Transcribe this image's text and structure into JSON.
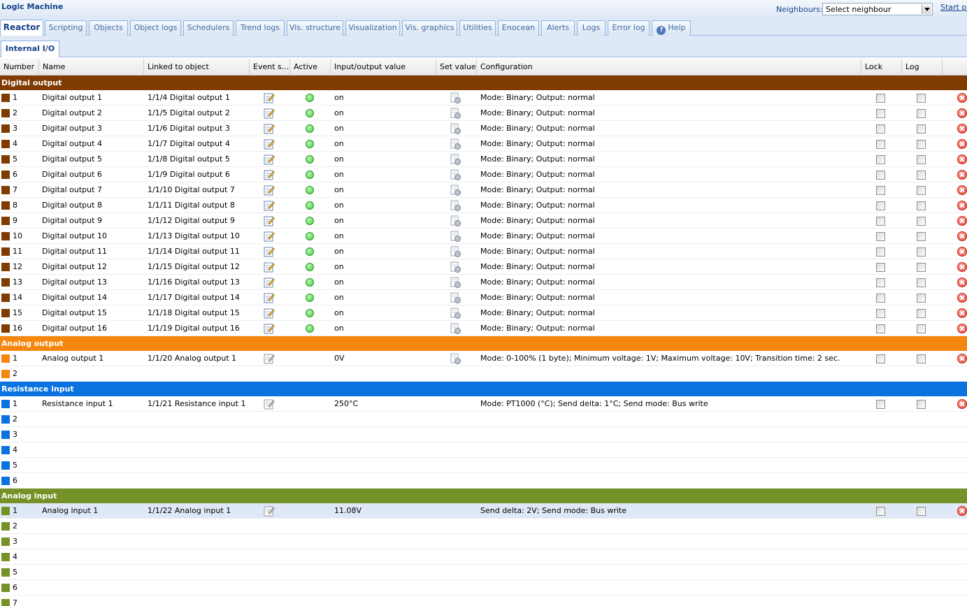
{
  "app": {
    "title": "Logic Machine",
    "neighbours_label": "Neighbours:",
    "neighbour_select": "Select neighbour",
    "start_link": "Start pa"
  },
  "tabs": [
    {
      "label": "Reactor",
      "active": true
    },
    {
      "label": "Scripting"
    },
    {
      "label": "Objects"
    },
    {
      "label": "Object logs"
    },
    {
      "label": "Schedulers"
    },
    {
      "label": "Trend logs"
    },
    {
      "label": "Vis. structure"
    },
    {
      "label": "Visualization"
    },
    {
      "label": "Vis. graphics"
    },
    {
      "label": "Utilities"
    },
    {
      "label": "Enocean"
    },
    {
      "label": "Alerts"
    },
    {
      "label": "Logs"
    },
    {
      "label": "Error log"
    },
    {
      "label": "Help"
    }
  ],
  "subtab": "Internal I/O",
  "columns": {
    "number": "Number",
    "name": "Name",
    "linked": "Linked to object",
    "event": "Event s...",
    "active": "Active",
    "io": "Input/output value",
    "set": "Set value",
    "config": "Configuration",
    "lock": "Lock",
    "log": "Log"
  },
  "colors": {
    "digital_output": "#7f3b00",
    "analog_output": "#f5870f",
    "resistance_input": "#0a73e0",
    "analog_input": "#759226"
  },
  "groups": {
    "digital_output": {
      "title": "Digital output",
      "rows": [
        {
          "n": "1",
          "name": "Digital output 1",
          "link": "1/1/4 Digital output 1",
          "io": "on",
          "conf": "Mode: Binary; Output: normal"
        },
        {
          "n": "2",
          "name": "Digital output 2",
          "link": "1/1/5 Digital output 2",
          "io": "on",
          "conf": "Mode: Binary; Output: normal"
        },
        {
          "n": "3",
          "name": "Digital output 3",
          "link": "1/1/6 Digital output 3",
          "io": "on",
          "conf": "Mode: Binary; Output: normal"
        },
        {
          "n": "4",
          "name": "Digital output 4",
          "link": "1/1/7 Digital output 4",
          "io": "on",
          "conf": "Mode: Binary; Output: normal"
        },
        {
          "n": "5",
          "name": "Digital output 5",
          "link": "1/1/8 Digital output 5",
          "io": "on",
          "conf": "Mode: Binary; Output: normal"
        },
        {
          "n": "6",
          "name": "Digital output 6",
          "link": "1/1/9 Digital output 6",
          "io": "on",
          "conf": "Mode: Binary; Output: normal"
        },
        {
          "n": "7",
          "name": "Digital output 7",
          "link": "1/1/10 Digital output 7",
          "io": "on",
          "conf": "Mode: Binary; Output: normal"
        },
        {
          "n": "8",
          "name": "Digital output 8",
          "link": "1/1/11 Digital output 8",
          "io": "on",
          "conf": "Mode: Binary; Output: normal"
        },
        {
          "n": "9",
          "name": "Digital output 9",
          "link": "1/1/12 Digital output 9",
          "io": "on",
          "conf": "Mode: Binary; Output: normal"
        },
        {
          "n": "10",
          "name": "Digital output 10",
          "link": "1/1/13 Digital output 10",
          "io": "on",
          "conf": "Mode: Binary; Output: normal"
        },
        {
          "n": "11",
          "name": "Digital output 11",
          "link": "1/1/14 Digital output 11",
          "io": "on",
          "conf": "Mode: Binary; Output: normal"
        },
        {
          "n": "12",
          "name": "Digital output 12",
          "link": "1/1/15 Digital output 12",
          "io": "on",
          "conf": "Mode: Binary; Output: normal"
        },
        {
          "n": "13",
          "name": "Digital output 13",
          "link": "1/1/16 Digital output 13",
          "io": "on",
          "conf": "Mode: Binary; Output: normal"
        },
        {
          "n": "14",
          "name": "Digital output 14",
          "link": "1/1/17 Digital output 14",
          "io": "on",
          "conf": "Mode: Binary; Output: normal"
        },
        {
          "n": "15",
          "name": "Digital output 15",
          "link": "1/1/18 Digital output 15",
          "io": "on",
          "conf": "Mode: Binary; Output: normal"
        },
        {
          "n": "16",
          "name": "Digital output 16",
          "link": "1/1/19 Digital output 16",
          "io": "on",
          "conf": "Mode: Binary; Output: normal"
        }
      ]
    },
    "analog_output": {
      "title": "Analog output",
      "rows": [
        {
          "n": "1",
          "name": "Analog output 1",
          "link": "1/1/20 Analog output 1",
          "io": "0V",
          "conf": "Mode: 0-100% (1 byte); Minimum voltage: 1V; Maximum voltage: 10V; Transition time: 2 sec."
        },
        {
          "n": "2"
        }
      ]
    },
    "resistance_input": {
      "title": "Resistance input",
      "rows": [
        {
          "n": "1",
          "name": "Resistance input 1",
          "link": "1/1/21 Resistance input 1",
          "io": "250°C",
          "conf": "Mode: PT1000 (°C); Send delta: 1°C; Send mode: Bus write"
        },
        {
          "n": "2"
        },
        {
          "n": "3"
        },
        {
          "n": "4"
        },
        {
          "n": "5"
        },
        {
          "n": "6"
        }
      ]
    },
    "analog_input": {
      "title": "Analog input",
      "rows": [
        {
          "n": "1",
          "name": "Analog input 1",
          "link": "1/1/22 Analog input 1",
          "io": "11.08V",
          "conf": "Send delta: 2V; Send mode: Bus write"
        },
        {
          "n": "2"
        },
        {
          "n": "3"
        },
        {
          "n": "4"
        },
        {
          "n": "5"
        },
        {
          "n": "6"
        },
        {
          "n": "7"
        }
      ]
    }
  }
}
